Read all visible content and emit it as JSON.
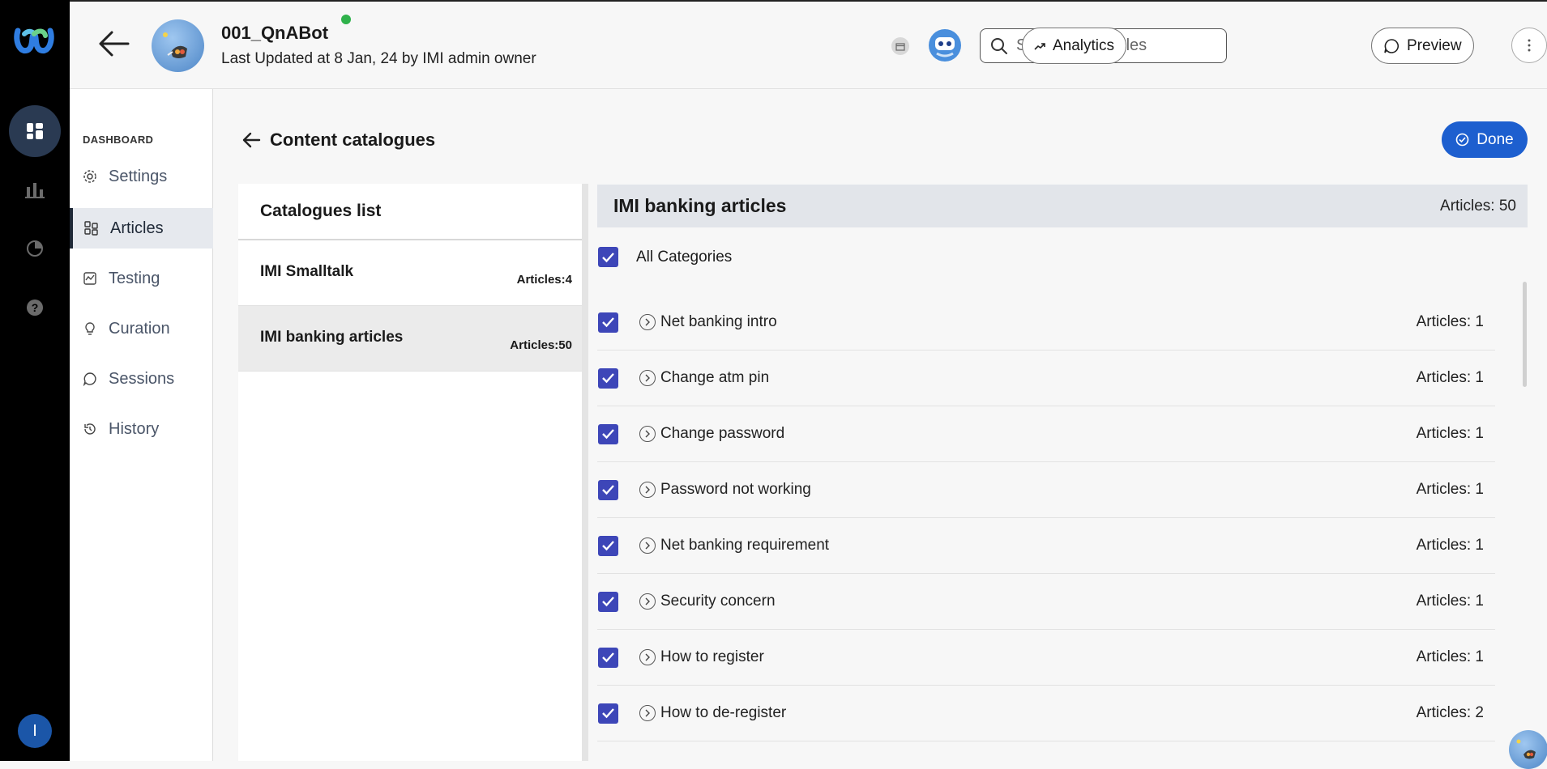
{
  "header": {
    "bot_name": "001_QnABot",
    "last_updated": "Last Updated at 8 Jan, 24 by IMI admin owner",
    "search_placeholder": "Search for articles",
    "analytics_label": "Analytics",
    "preview_label": "Preview"
  },
  "rail": {
    "user_initial": "I",
    "icons": [
      "dashboard-icon",
      "bar-chart-icon",
      "pie-chart-icon",
      "help-icon"
    ]
  },
  "sidebar": {
    "section": "DASHBOARD",
    "items": [
      {
        "label": "Settings",
        "icon": "gear-icon"
      },
      {
        "label": "Articles",
        "icon": "articles-icon",
        "active": true
      },
      {
        "label": "Testing",
        "icon": "testing-icon"
      },
      {
        "label": "Curation",
        "icon": "lightbulb-icon"
      },
      {
        "label": "Sessions",
        "icon": "chat-icon"
      },
      {
        "label": "History",
        "icon": "history-icon"
      }
    ]
  },
  "content": {
    "title": "Content catalogues",
    "done_label": "Done"
  },
  "catalogues": {
    "header": "Catalogues list",
    "items": [
      {
        "name": "IMI Smalltalk",
        "count": "Articles:4"
      },
      {
        "name": "IMI banking articles",
        "count": "Articles:50",
        "selected": true
      }
    ]
  },
  "detail": {
    "title": "IMI banking articles",
    "count": "Articles: 50",
    "all_categories": "All Categories",
    "rows": [
      {
        "label": "Net banking intro",
        "count": "Articles: 1"
      },
      {
        "label": "Change atm pin",
        "count": "Articles: 1"
      },
      {
        "label": "Change password",
        "count": "Articles: 1"
      },
      {
        "label": "Password not working",
        "count": "Articles: 1"
      },
      {
        "label": "Net banking requirement",
        "count": "Articles: 1"
      },
      {
        "label": "Security concern",
        "count": "Articles: 1"
      },
      {
        "label": "How to register",
        "count": "Articles: 1"
      },
      {
        "label": "How to de-register",
        "count": "Articles: 2"
      }
    ]
  },
  "colors": {
    "accent": "#1d5fcf",
    "checkbox": "#3d46b8",
    "online": "#2fb24b"
  }
}
